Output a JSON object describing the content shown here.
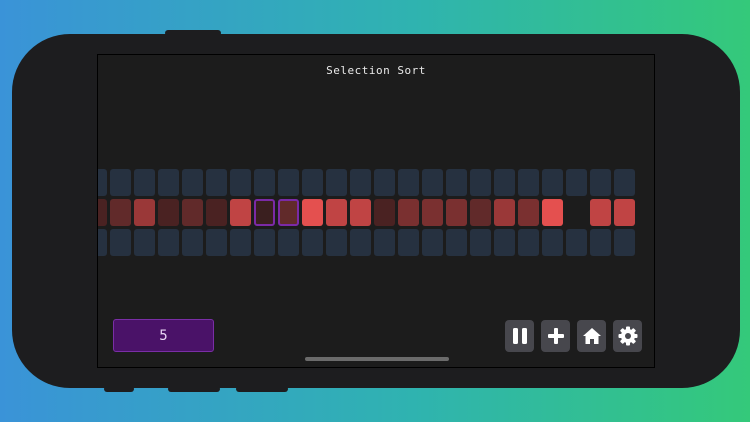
{
  "app": {
    "title": "Selection Sort"
  },
  "counter": {
    "value": "5"
  },
  "colors": {
    "empty": "#263140",
    "selected_border": "#7b2aa6",
    "shades": [
      "#3a1f1f",
      "#4a2222",
      "#612a2a",
      "#7a3030",
      "#9a3838",
      "#c04444",
      "#e4504f"
    ]
  },
  "grid": {
    "top_row_count": 23,
    "bottom_row_count": 23,
    "middle_row": [
      {
        "shade": 1
      },
      {
        "shade": 2
      },
      {
        "shade": 4
      },
      {
        "shade": 1
      },
      {
        "shade": 2
      },
      {
        "shade": 1
      },
      {
        "shade": 5
      },
      {
        "shade": 0,
        "selected": true
      },
      {
        "shade": 2,
        "selected": true
      },
      {
        "shade": 6
      },
      {
        "shade": 5
      },
      {
        "shade": 5
      },
      {
        "shade": 1
      },
      {
        "shade": 3
      },
      {
        "shade": 3
      },
      {
        "shade": 3
      },
      {
        "shade": 2
      },
      {
        "shade": 4
      },
      {
        "shade": 3
      },
      {
        "shade": 6
      },
      {
        "shade": -1
      },
      {
        "shade": 5
      },
      {
        "shade": 5
      }
    ]
  },
  "toolbar": {
    "buttons": [
      {
        "name": "pause-button",
        "icon": "pause-icon"
      },
      {
        "name": "add-button",
        "icon": "plus-icon"
      },
      {
        "name": "home-button",
        "icon": "home-icon"
      },
      {
        "name": "settings-button",
        "icon": "gear-icon"
      }
    ]
  }
}
